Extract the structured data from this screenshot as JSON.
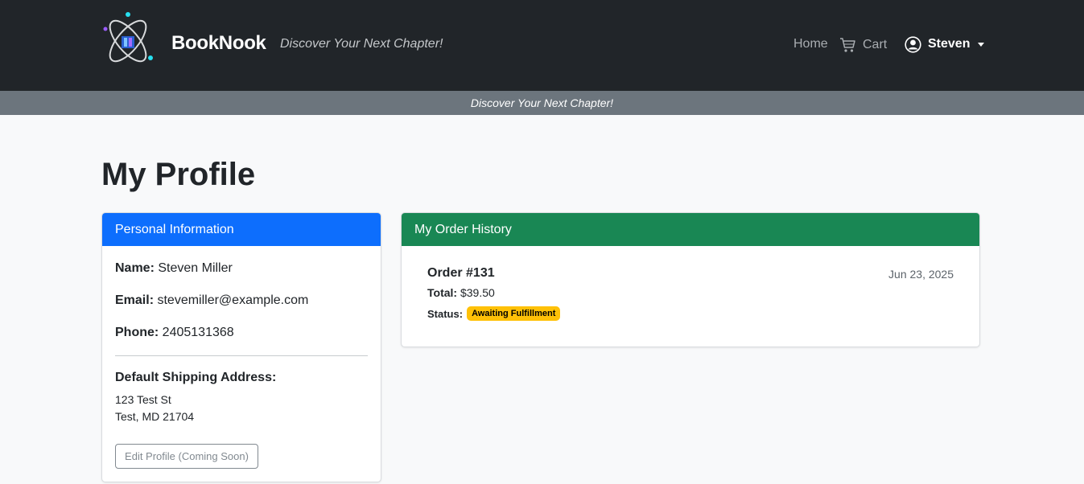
{
  "navbar": {
    "brand_name": "BookNook",
    "tagline": "Discover Your Next Chapter!",
    "links": {
      "home": "Home",
      "cart": "Cart"
    },
    "user": {
      "name": "Steven"
    },
    "icons": {
      "logo": "atom-book-logo",
      "cart": "cart-icon",
      "user": "user-circle-icon",
      "caret": "caret-down-icon"
    }
  },
  "tagline_bar": {
    "text": "Discover Your Next Chapter!"
  },
  "page": {
    "title": "My Profile"
  },
  "personal": {
    "header": "Personal Information",
    "name_label": "Name:",
    "name_value": "Steven Miller",
    "email_label": "Email:",
    "email_value": "stevemiller@example.com",
    "phone_label": "Phone:",
    "phone_value": "2405131368",
    "shipping_heading": "Default Shipping Address:",
    "address_line1": "123 Test St",
    "address_line2": "Test, MD 21704",
    "edit_button": "Edit Profile (Coming Soon)"
  },
  "orders": {
    "header": "My Order History",
    "items": [
      {
        "title": "Order #131",
        "date": "Jun 23, 2025",
        "total_label": "Total:",
        "total_value": "$39.50",
        "status_label": "Status:",
        "status_value": "Awaiting Fulfillment"
      }
    ]
  },
  "colors": {
    "navbar": "#212529",
    "tagline_bar": "#6c757d",
    "personal_header": "#0d6efd",
    "orders_header": "#198754",
    "status_badge": "#ffc107"
  }
}
